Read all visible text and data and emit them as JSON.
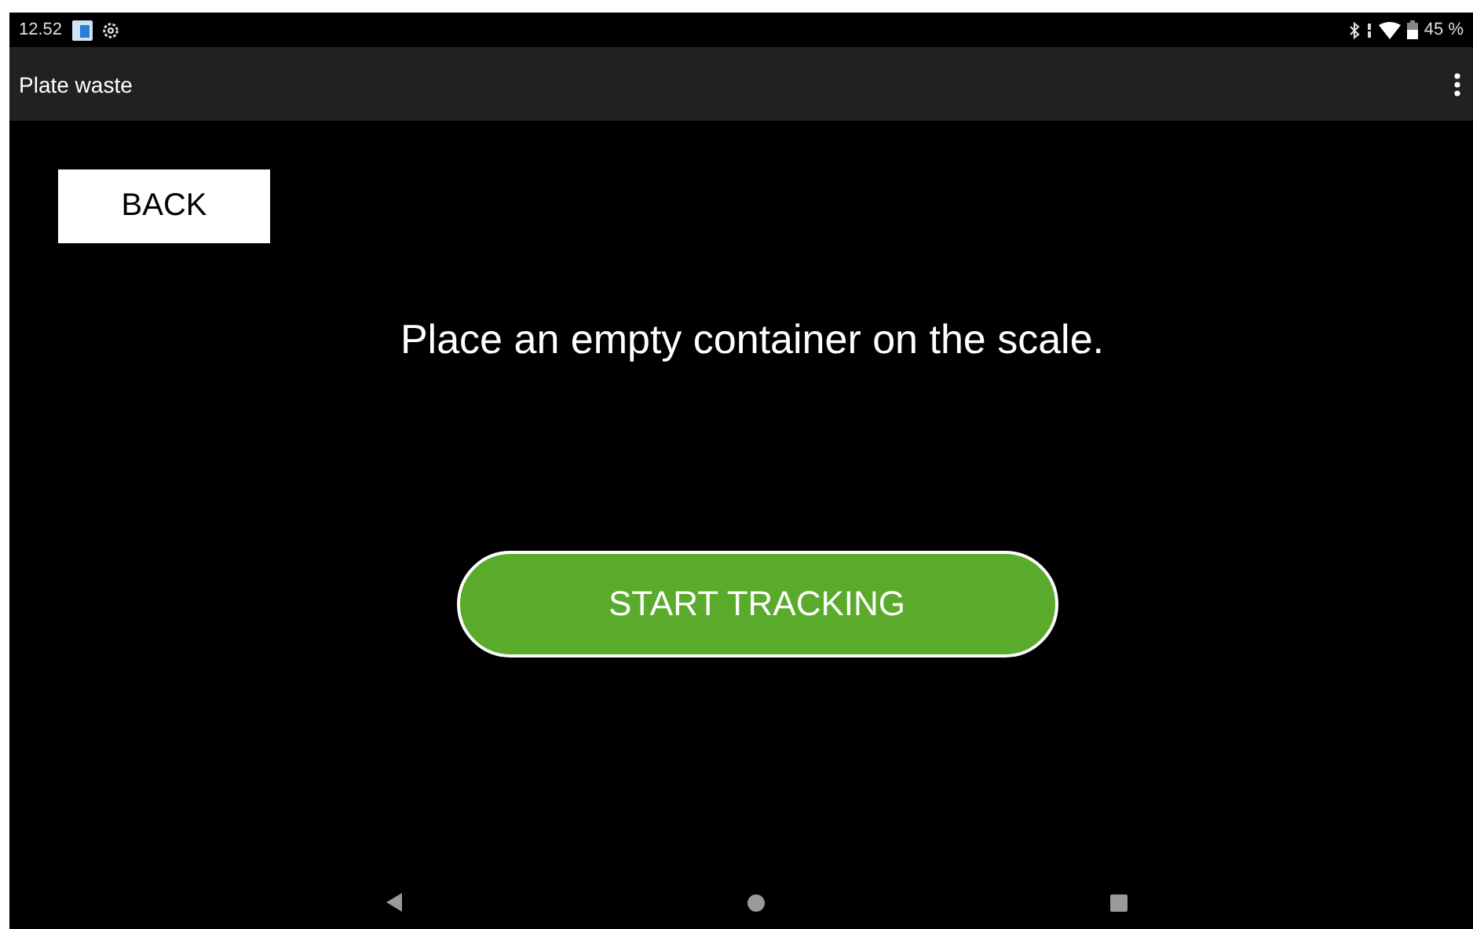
{
  "status_bar": {
    "time": "12.52",
    "battery": "45 %"
  },
  "app_bar": {
    "title": "Plate waste"
  },
  "back_button": {
    "label": "BACK"
  },
  "instruction": "Place an empty container on the scale.",
  "start_button": {
    "label": "START TRACKING"
  }
}
